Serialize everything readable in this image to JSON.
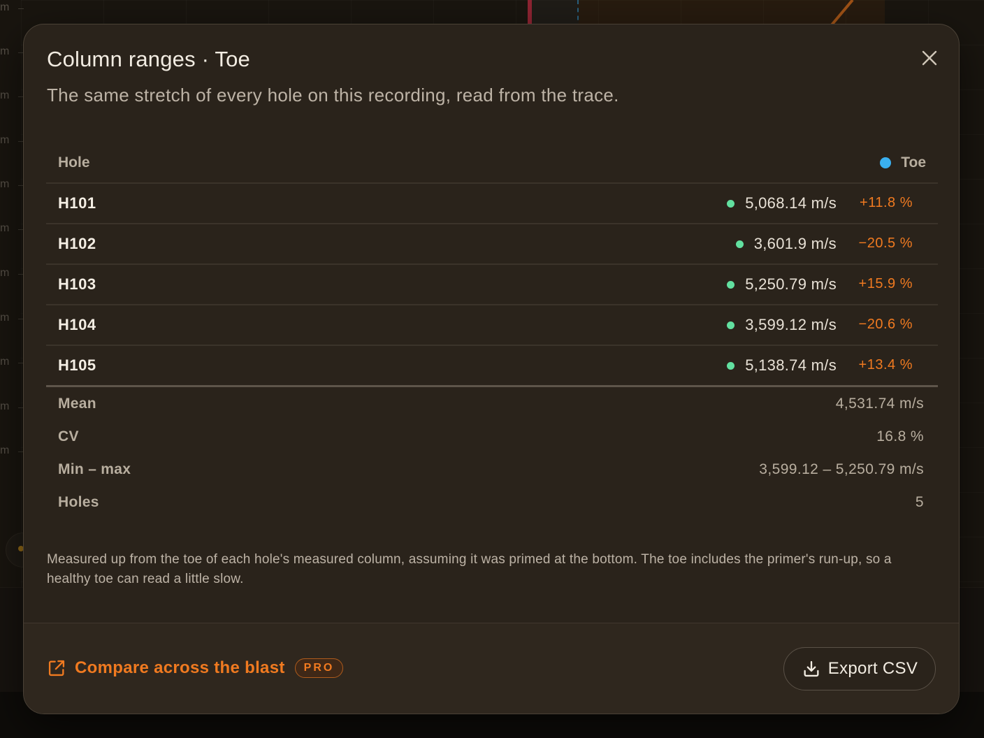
{
  "background": {
    "axis_ticks": [
      "m",
      "m",
      "m",
      "m",
      "m",
      "m",
      "m",
      "m",
      "m",
      "m",
      "m"
    ]
  },
  "modal": {
    "title": "Column ranges · Toe",
    "subtitle": "The same stretch of every hole on this recording, read from the trace.",
    "close_icon": "close-icon",
    "table": {
      "header": {
        "hole": "Hole",
        "series": "Toe",
        "series_color": "#3ab0f0"
      },
      "rows": [
        {
          "hole": "H101",
          "value": "5,068.14 m/s",
          "deviation": "+11.8 %"
        },
        {
          "hole": "H102",
          "value": "3,601.9 m/s",
          "deviation": "−20.5 %"
        },
        {
          "hole": "H103",
          "value": "5,250.79 m/s",
          "deviation": "+15.9 %"
        },
        {
          "hole": "H104",
          "value": "3,599.12 m/s",
          "deviation": "−20.6 %"
        },
        {
          "hole": "H105",
          "value": "5,138.74 m/s",
          "deviation": "+13.4 %"
        }
      ],
      "stats": [
        {
          "label": "Mean",
          "value": "4,531.74 m/s"
        },
        {
          "label": "CV",
          "value": "16.8 %"
        },
        {
          "label": "Min – max",
          "value": "3,599.12 – 5,250.79 m/s"
        },
        {
          "label": "Holes",
          "value": "5"
        }
      ]
    },
    "note": "Measured up from the toe of each hole's measured column, assuming it was primed at the bottom. The toe includes the primer's run-up, so a healthy toe can read a little slow.",
    "footer": {
      "compare_label": "Compare across the blast",
      "pro_badge": "PRO",
      "export_label": "Export CSV"
    }
  },
  "colors": {
    "accent": "#f07a20",
    "status_dot": "#62e0a0",
    "modal_bg": "#2a231b"
  }
}
